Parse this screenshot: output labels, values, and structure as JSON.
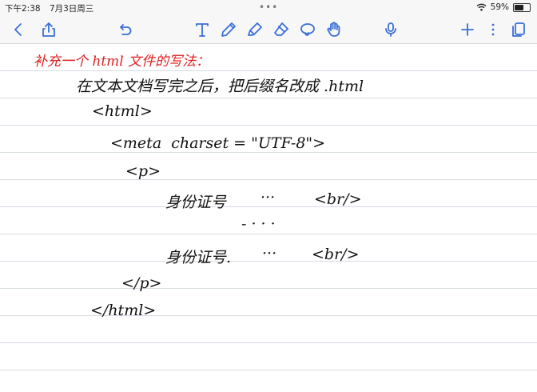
{
  "status_bar": {
    "time": "下午2:38",
    "date": "7月3日周三",
    "dots": "•••",
    "battery": "59%"
  },
  "toolbar": {
    "icons": [
      "back-icon",
      "share-icon",
      "undo-icon",
      "text-tool-icon",
      "pen-icon",
      "highlighter-icon",
      "eraser-icon",
      "lasso-icon",
      "hand-icon",
      "microphone-icon",
      "add-icon",
      "more-icon",
      "pages-icon"
    ]
  },
  "note": {
    "heading": "补充一个 html 文件的写法：",
    "line1": "在文本文档写完之后，把后缀名改成 .html",
    "line2": "<html>",
    "line3": "<meta  charset = \"UTF-8\">",
    "line4": "<p>",
    "line5a": "身份证号",
    "line5b": "···",
    "line5c": "<br/>",
    "line6": "- · · ·",
    "line7a": "身份证号.",
    "line7b": "···",
    "line7c": "<br/>",
    "line8": "</p>",
    "line9": "</html>"
  }
}
